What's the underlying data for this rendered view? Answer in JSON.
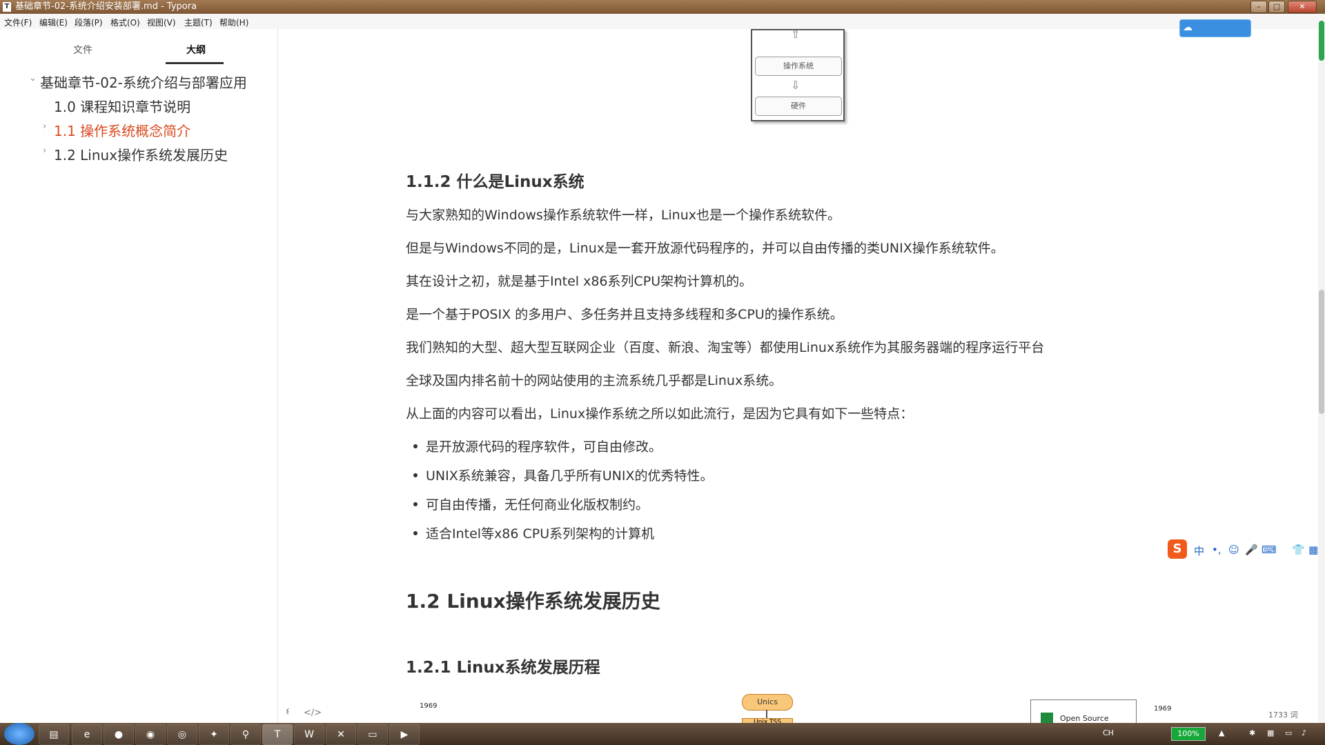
{
  "window": {
    "title": "基础章节-02-系统介绍安装部署.md - Typora"
  },
  "menubar": [
    "文件(F)",
    "编辑(E)",
    "段落(P)",
    "格式(O)",
    "视图(V)",
    "主题(T)",
    "帮助(H)"
  ],
  "sidebar": {
    "tabs": [
      "文件",
      "大纲"
    ],
    "active_tab": "大纲",
    "outline": [
      {
        "label": "基础章节-02-系统介绍与部署应用",
        "arrow": "⌄"
      },
      {
        "label": "1.0 课程知识章节说明",
        "arrow": ""
      },
      {
        "label": "1.1 操作系统概念简介",
        "arrow": "›",
        "active": true
      },
      {
        "label": "1.2 Linux操作系统发展历史",
        "arrow": "›"
      }
    ],
    "footer": {
      "back": "‹",
      "source": "</>"
    }
  },
  "diagram_top": {
    "nodes": [
      "操作系统",
      "硬件"
    ]
  },
  "document": {
    "h3_1": "1.1.2 什么是Linux系统",
    "paragraphs": [
      "与大家熟知的Windows操作系统软件一样，Linux也是一个操作系统软件。",
      "但是与Windows不同的是，Linux是一套开放源代码程序的，并可以自由传播的类UNIX操作系统软件。",
      "其在设计之初，就是基于Intel x86系列CPU架构计算机的。",
      "是一个基于POSIX 的多用户、多任务并且支持多线程和多CPU的操作系统。",
      "我们熟知的大型、超大型互联网企业（百度、新浪、淘宝等）都使用Linux系统作为其服务器端的程序运行平台",
      "全球及国内排名前十的网站使用的主流系统几乎都是Linux系统。",
      "从上面的内容可以看出，Linux操作系统之所以如此流行，是因为它具有如下一些特点："
    ],
    "bullets": [
      "是开放源代码的程序软件，可自由修改。",
      "UNIX系统兼容，具备几乎所有UNIX的优秀特性。",
      "可自由传播，无任何商业化版权制约。",
      "适合Intel等x86 CPU系列架构的计算机"
    ],
    "h2": "1.2 Linux操作系统发展历史",
    "h3_2": "1.2.1 Linux系统发展历程"
  },
  "diagram_bottom": {
    "year_left": "1969",
    "year_right": "1969",
    "unics": "Unics",
    "unix_tss": "Unix TSS",
    "legend": "Open Source"
  },
  "status": {
    "word_count": "1733 词"
  },
  "ime": {
    "chars": [
      "中",
      "•,",
      "☺",
      "🎤",
      "⌨",
      "👕",
      "▦"
    ]
  },
  "taskbar": {
    "battery": "100%",
    "lang": "CH"
  },
  "colors": {
    "titlebar": "#8a6440",
    "active_outline": "#d9491f",
    "text": "#333333"
  }
}
